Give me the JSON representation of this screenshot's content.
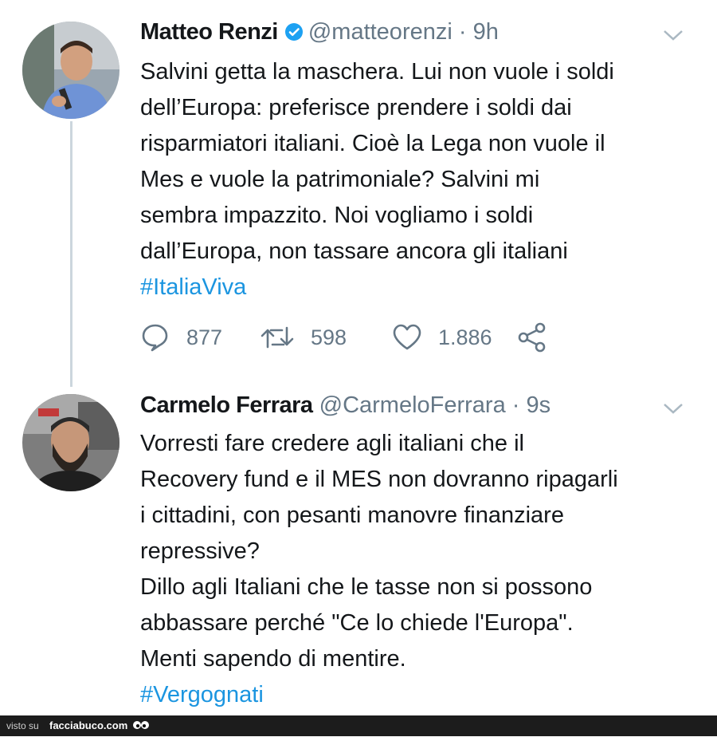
{
  "tweets": [
    {
      "name": "Matteo Renzi",
      "handle": "@matteorenzi",
      "time": "· 9h",
      "text": "Salvini getta la maschera. Lui non vuole i soldi\ndell’Europa: preferisce prendere i soldi dai\nrisparmiatori italiani. Cioè la Lega non vuole il\nMes e vuole la patrimoniale? Salvini mi\nsembra impazzito. Noi vogliamo i soldi\ndall’Europa, non tassare ancora gli italiani",
      "hashtag": "#ItaliaViva",
      "replies": "877",
      "retweets": "598",
      "likes": "1.886"
    },
    {
      "name": "Carmelo Ferrara",
      "handle": "@CarmeloFerrara",
      "time": "· 9s",
      "text": "Vorresti fare credere agli italiani che il\nRecovery fund e il MES non dovranno ripagarli\ni cittadini, con pesanti manovre finanziare\nrepressive?\nDillo agli Italiani che le tasse non si possono\nabbassare perché \"Ce lo chiede l'Europa\".\nMenti sapendo di mentire.",
      "hashtag": "#Vergognati"
    }
  ],
  "footer": {
    "prefix": "visto su",
    "brand": "facciabuco.com"
  },
  "colors": {
    "link": "#1b95e0",
    "secondary": "#657786",
    "verified": "#1da1f2"
  }
}
